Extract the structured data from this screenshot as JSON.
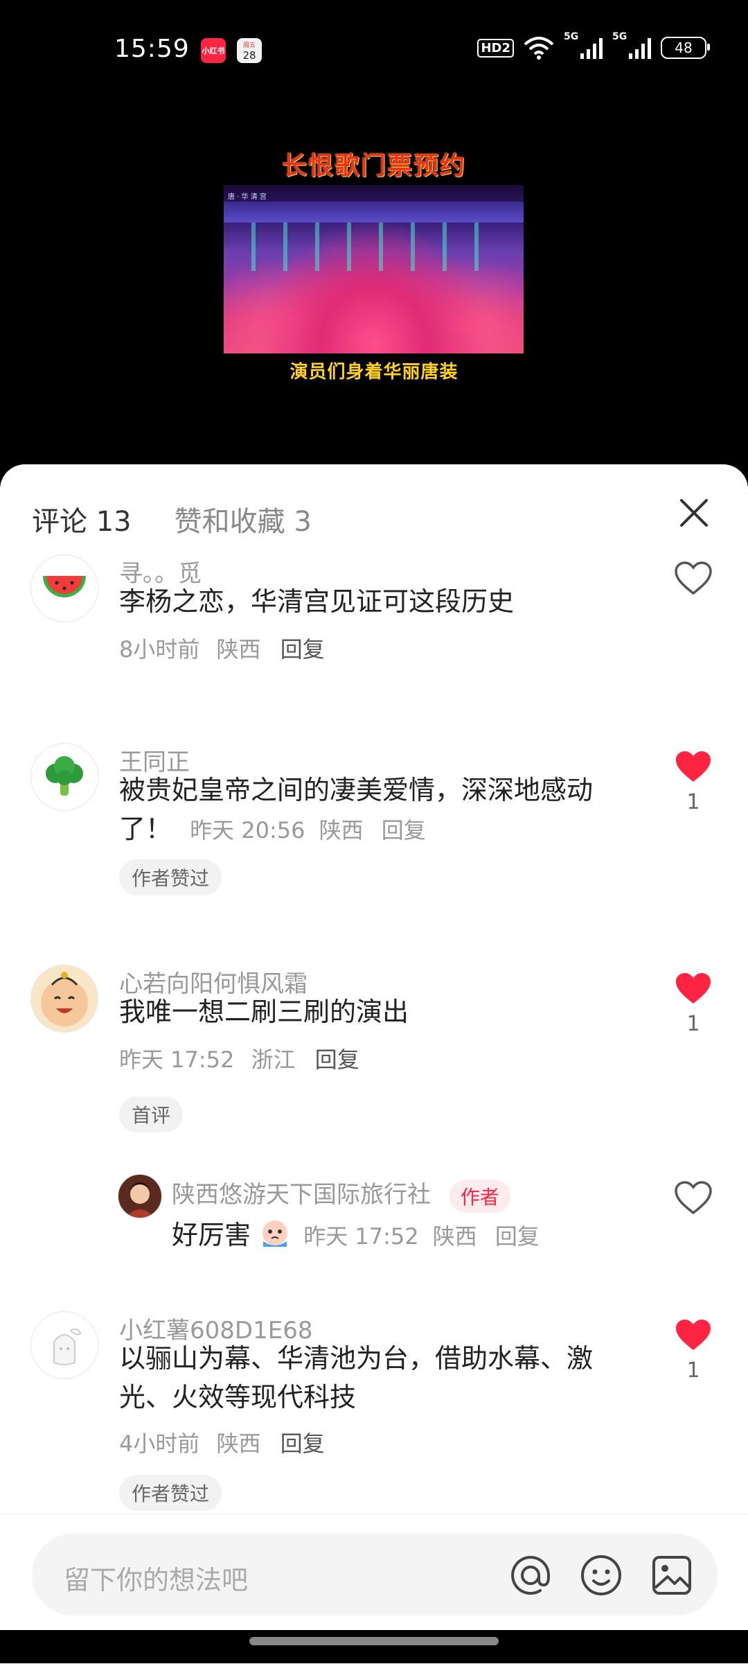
{
  "status_bar": {
    "time": "15:59",
    "app1_label": "小红书",
    "cal_top": "周五",
    "cal_day": "28",
    "hd_label": "HD2",
    "net1": "5G",
    "net2": "5G",
    "battery": "48"
  },
  "video": {
    "title": "长恨歌门票预约",
    "stage_text": "唐 · 华 清 宫",
    "subtitle": "演员们身着华丽唐装"
  },
  "tabs": [
    {
      "label": "评论 13"
    },
    {
      "label": "赞和收藏 3"
    }
  ],
  "comments": [
    {
      "user": "寻。。觅",
      "text": "李杨之恋，华清宫见证可这段历史",
      "time": "8小时前",
      "location": "陕西",
      "reply": "回复",
      "liked": false,
      "likes": ""
    },
    {
      "user": "王同正",
      "text": "被贵妃皇帝之间的凄美爱情，深深地感动了！",
      "time": "昨天 20:56",
      "location": "陕西",
      "reply": "回复",
      "badge": "作者赞过",
      "liked": true,
      "likes": "1"
    },
    {
      "user": "心若向阳何惧风霜",
      "text": "我唯一想二刷三刷的演出",
      "time": "昨天 17:52",
      "location": "浙江",
      "reply": "回复",
      "badge": "首评",
      "liked": true,
      "likes": "1"
    },
    {
      "user": "小红薯608D1E68",
      "text": "以骊山为幕、华清池为台，借助水幕、激光、火效等现代科技",
      "time": "4小时前",
      "location": "陕西",
      "reply": "回复",
      "badge": "作者赞过",
      "liked": true,
      "likes": "1"
    }
  ],
  "reply": {
    "user": "陕西悠游天下国际旅行社",
    "author_tag": "作者",
    "text": "好厉害",
    "time": "昨天 17:52",
    "location": "陕西",
    "reply": "回复",
    "liked": false
  },
  "input": {
    "placeholder": "留下你的想法吧",
    "icons": [
      "at-icon",
      "emoji-icon",
      "image-icon"
    ]
  },
  "colors": {
    "like_red": "#ff2442",
    "author_tag_bg": "#fdecee"
  }
}
